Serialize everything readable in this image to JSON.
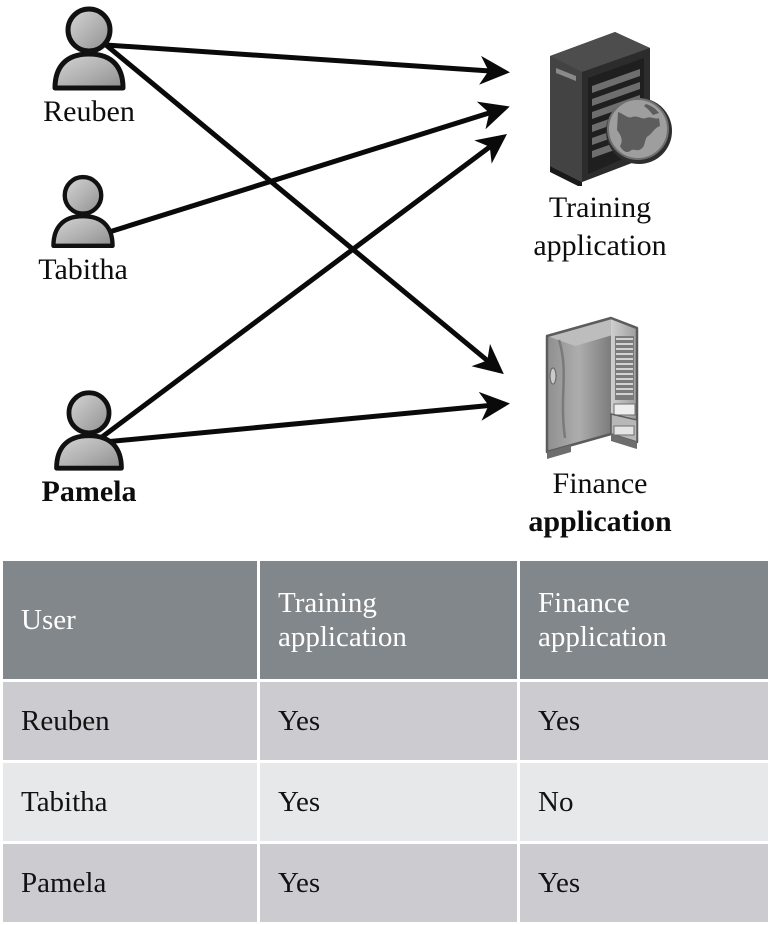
{
  "diagram": {
    "type": "access-mapping-diagram",
    "users": [
      {
        "id": "reuben",
        "label": "Reuben",
        "icon": "user-icon",
        "bold": false
      },
      {
        "id": "tabitha",
        "label": "Tabitha",
        "icon": "user-icon",
        "bold": false
      },
      {
        "id": "pamela",
        "label": "Pamela",
        "icon": "user-icon",
        "bold": true
      }
    ],
    "applications": [
      {
        "id": "training",
        "label_line1": "Training",
        "label_line2": "application",
        "icon": "server-rack-globe-icon",
        "bold_line2": false
      },
      {
        "id": "finance",
        "label_line1": "Finance",
        "label_line2": "application",
        "icon": "desktop-tower-icon",
        "bold_line2": true
      }
    ],
    "connections": [
      {
        "from": "reuben",
        "to": "training"
      },
      {
        "from": "reuben",
        "to": "finance"
      },
      {
        "from": "tabitha",
        "to": "training"
      },
      {
        "from": "pamela",
        "to": "training"
      },
      {
        "from": "pamela",
        "to": "finance"
      }
    ]
  },
  "table": {
    "headers": [
      "User",
      "Training\napplication",
      "Finance\napplication"
    ],
    "header_user": "User",
    "header_training_l1": "Training",
    "header_training_l2": "application",
    "header_finance_l1": "Finance",
    "header_finance_l2": "application",
    "rows": [
      {
        "user": "Reuben",
        "training": "Yes",
        "finance": "Yes"
      },
      {
        "user": "Tabitha",
        "training": "Yes",
        "finance": "No"
      },
      {
        "user": "Pamela",
        "training": "Yes",
        "finance": "Yes"
      }
    ]
  },
  "colors": {
    "header_bg": "#82878b",
    "header_text": "#ffffff",
    "row_odd_bg": "#ccccd0",
    "row_even_bg": "#e7e8ea",
    "text": "#121212",
    "muted_text": "#6d6d72",
    "arrow": "#0a0a0a",
    "user_icon_fill": "#b4b4b4",
    "server_dark": "#3a3a3a",
    "tower_light": "#9a9a9a"
  }
}
